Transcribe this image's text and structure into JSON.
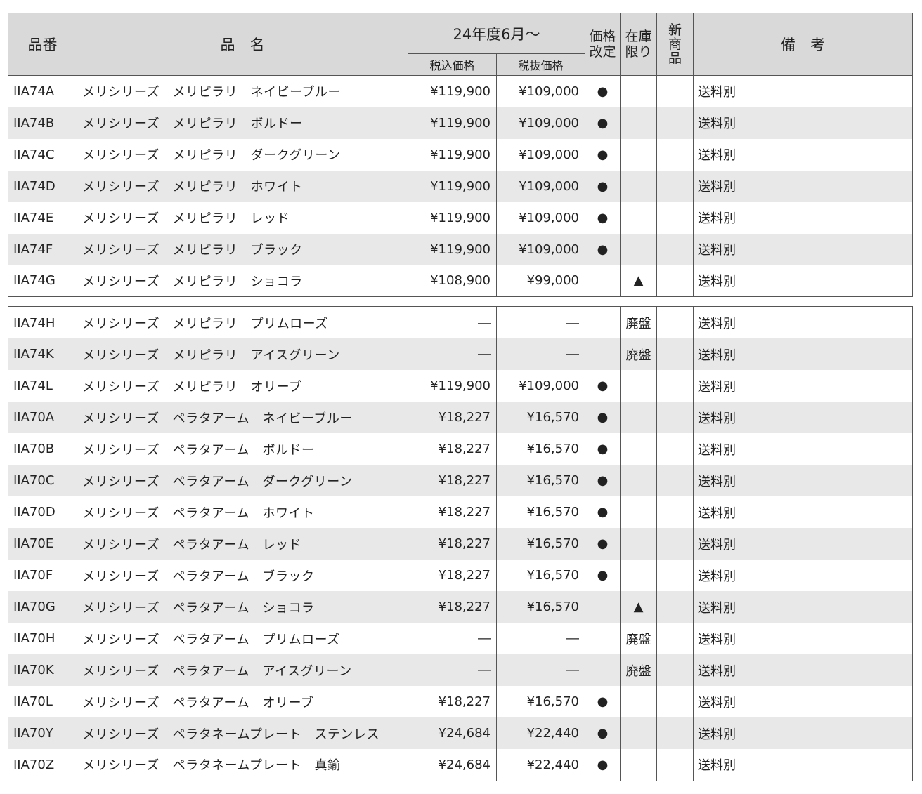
{
  "header": {
    "code": "品番",
    "name": "品　名",
    "price_period": "24年度6月～",
    "tax_incl": "税込価格",
    "tax_excl": "税抜価格",
    "price_revised_l1": "価格",
    "price_revised_l2": "改定",
    "stock_only_l1": "在庫",
    "stock_only_l2": "限り",
    "new_l1": "新",
    "new_l2": "商",
    "new_l3": "品",
    "note": "備　考"
  },
  "symbols": {
    "price_revised": "●",
    "stock_limited": "▲"
  },
  "section1": [
    {
      "code": "IIA74A",
      "name": "メリシリーズ　メリピラリ　ネイビーブルー",
      "incl": "¥119,900",
      "excl": "¥109,000",
      "revised": "●",
      "stock": "",
      "new": "",
      "note": "送料別"
    },
    {
      "code": "IIA74B",
      "name": "メリシリーズ　メリピラリ　ボルドー",
      "incl": "¥119,900",
      "excl": "¥109,000",
      "revised": "●",
      "stock": "",
      "new": "",
      "note": "送料別"
    },
    {
      "code": "IIA74C",
      "name": "メリシリーズ　メリピラリ　ダークグリーン",
      "incl": "¥119,900",
      "excl": "¥109,000",
      "revised": "●",
      "stock": "",
      "new": "",
      "note": "送料別"
    },
    {
      "code": "IIA74D",
      "name": "メリシリーズ　メリピラリ　ホワイト",
      "incl": "¥119,900",
      "excl": "¥109,000",
      "revised": "●",
      "stock": "",
      "new": "",
      "note": "送料別"
    },
    {
      "code": "IIA74E",
      "name": "メリシリーズ　メリピラリ　レッド",
      "incl": "¥119,900",
      "excl": "¥109,000",
      "revised": "●",
      "stock": "",
      "new": "",
      "note": "送料別"
    },
    {
      "code": "IIA74F",
      "name": "メリシリーズ　メリピラリ　ブラック",
      "incl": "¥119,900",
      "excl": "¥109,000",
      "revised": "●",
      "stock": "",
      "new": "",
      "note": "送料別"
    },
    {
      "code": "IIA74G",
      "name": "メリシリーズ　メリピラリ　ショコラ",
      "incl": "¥108,900",
      "excl": "¥99,000",
      "revised": "",
      "stock": "▲",
      "new": "",
      "note": "送料別"
    }
  ],
  "section2": [
    {
      "code": "IIA74H",
      "name": "メリシリーズ　メリピラリ　プリムローズ",
      "incl": "―",
      "excl": "―",
      "revised": "",
      "stock": "廃盤",
      "new": "",
      "note": "送料別"
    },
    {
      "code": "IIA74K",
      "name": "メリシリーズ　メリピラリ　アイスグリーン",
      "incl": "―",
      "excl": "―",
      "revised": "",
      "stock": "廃盤",
      "new": "",
      "note": "送料別"
    },
    {
      "code": "IIA74L",
      "name": "メリシリーズ　メリピラリ　オリーブ",
      "incl": "¥119,900",
      "excl": "¥109,000",
      "revised": "●",
      "stock": "",
      "new": "",
      "note": "送料別"
    },
    {
      "code": "IIA70A",
      "name": "メリシリーズ　ペラタアーム　ネイビーブルー",
      "incl": "¥18,227",
      "excl": "¥16,570",
      "revised": "●",
      "stock": "",
      "new": "",
      "note": "送料別"
    },
    {
      "code": "IIA70B",
      "name": "メリシリーズ　ペラタアーム　ボルドー",
      "incl": "¥18,227",
      "excl": "¥16,570",
      "revised": "●",
      "stock": "",
      "new": "",
      "note": "送料別"
    },
    {
      "code": "IIA70C",
      "name": "メリシリーズ　ペラタアーム　ダークグリーン",
      "incl": "¥18,227",
      "excl": "¥16,570",
      "revised": "●",
      "stock": "",
      "new": "",
      "note": "送料別"
    },
    {
      "code": "IIA70D",
      "name": "メリシリーズ　ペラタアーム　ホワイト",
      "incl": "¥18,227",
      "excl": "¥16,570",
      "revised": "●",
      "stock": "",
      "new": "",
      "note": "送料別"
    },
    {
      "code": "IIA70E",
      "name": "メリシリーズ　ペラタアーム　レッド",
      "incl": "¥18,227",
      "excl": "¥16,570",
      "revised": "●",
      "stock": "",
      "new": "",
      "note": "送料別"
    },
    {
      "code": "IIA70F",
      "name": "メリシリーズ　ペラタアーム　ブラック",
      "incl": "¥18,227",
      "excl": "¥16,570",
      "revised": "●",
      "stock": "",
      "new": "",
      "note": "送料別"
    },
    {
      "code": "IIA70G",
      "name": "メリシリーズ　ペラタアーム　ショコラ",
      "incl": "¥18,227",
      "excl": "¥16,570",
      "revised": "",
      "stock": "▲",
      "new": "",
      "note": "送料別"
    },
    {
      "code": "IIA70H",
      "name": "メリシリーズ　ペラタアーム　プリムローズ",
      "incl": "―",
      "excl": "―",
      "revised": "",
      "stock": "廃盤",
      "new": "",
      "note": "送料別"
    },
    {
      "code": "IIA70K",
      "name": "メリシリーズ　ペラタアーム　アイスグリーン",
      "incl": "―",
      "excl": "―",
      "revised": "",
      "stock": "廃盤",
      "new": "",
      "note": "送料別"
    },
    {
      "code": "IIA70L",
      "name": "メリシリーズ　ペラタアーム　オリーブ",
      "incl": "¥18,227",
      "excl": "¥16,570",
      "revised": "●",
      "stock": "",
      "new": "",
      "note": "送料別"
    },
    {
      "code": "IIA70Y",
      "name": "メリシリーズ　ペラタネームプレート　ステンレス",
      "incl": "¥24,684",
      "excl": "¥22,440",
      "revised": "●",
      "stock": "",
      "new": "",
      "note": "送料別"
    },
    {
      "code": "IIA70Z",
      "name": "メリシリーズ　ペラタネームプレート　真鍮",
      "incl": "¥24,684",
      "excl": "¥22,440",
      "revised": "●",
      "stock": "",
      "new": "",
      "note": "送料別"
    }
  ],
  "colors": {
    "header_bg": "#d9d9d9",
    "alt_row_bg": "#e8e8e8",
    "border": "#555555"
  }
}
